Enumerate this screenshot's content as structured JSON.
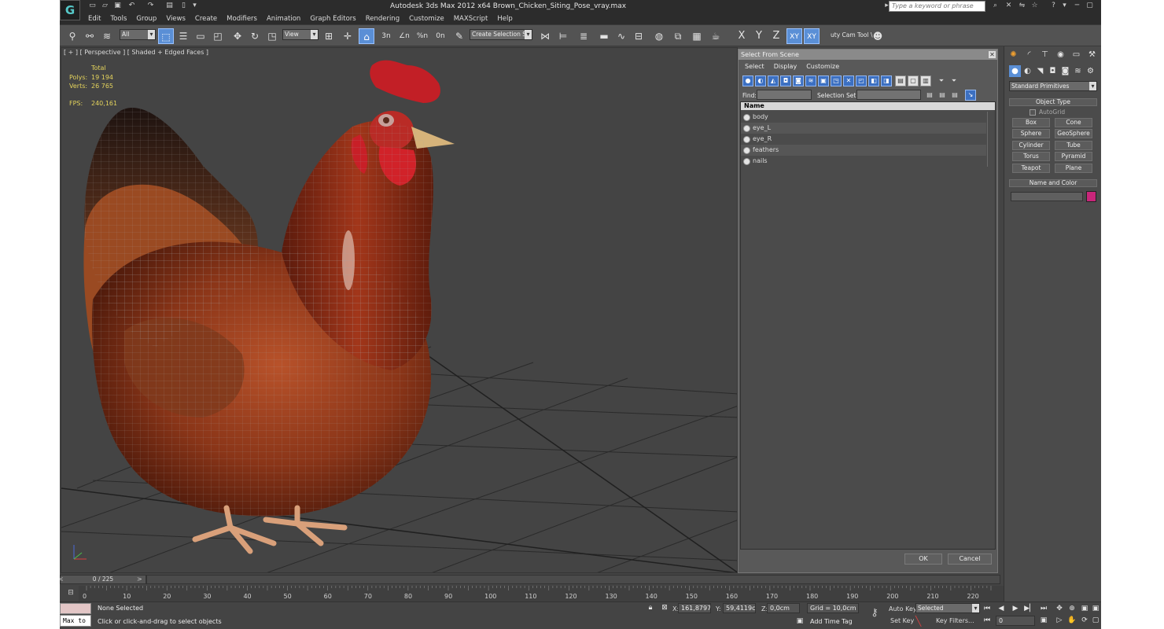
{
  "app": {
    "title": "Autodesk 3ds Max  2012 x64     Brown_Chicken_Siting_Pose_vray.max",
    "search_placeholder": "Type a keyword or phrase",
    "logo_letter": "G"
  },
  "menus": [
    "Edit",
    "Tools",
    "Group",
    "Views",
    "Create",
    "Modifiers",
    "Animation",
    "Graph Editors",
    "Rendering",
    "Customize",
    "MAXScript",
    "Help"
  ],
  "toolbar": {
    "filter_value": "All",
    "refcoord_value": "View",
    "named_selection_value": "Create Selection Se",
    "snap_labels": [
      "3n",
      "∠n",
      "%n",
      "0n"
    ],
    "axis_labels": [
      "X",
      "Y",
      "Z",
      "XY",
      "XY"
    ],
    "utility_label": "uty Cam Tool \\"
  },
  "viewport": {
    "label": "[ + ] [ Perspective ] [ Shaded + Edged Faces ]",
    "stats": {
      "total_label": "Total",
      "polys_label": "Polys:",
      "polys_value": "19 194",
      "verts_label": "Verts:",
      "verts_value": "26 765",
      "fps_label": "FPS:",
      "fps_value": "240,161"
    }
  },
  "dialog": {
    "title": "Select From Scene",
    "menus": [
      "Select",
      "Display",
      "Customize"
    ],
    "find_label": "Find:",
    "find_value": "",
    "selection_set_label": "Selection Set:",
    "selection_set_value": "",
    "column_header": "Name",
    "items": [
      "body",
      "eye_L",
      "eye_R",
      "feathers",
      "nails"
    ],
    "ok_label": "OK",
    "cancel_label": "Cancel"
  },
  "command_panel": {
    "category_value": "Standard Primitives",
    "object_type_title": "Object Type",
    "autogrid_label": "AutoGrid",
    "primitives": [
      "Box",
      "Cone",
      "Sphere",
      "GeoSphere",
      "Cylinder",
      "Tube",
      "Torus",
      "Pyramid",
      "Teapot",
      "Plane"
    ],
    "name_color_title": "Name and Color",
    "object_name_value": "",
    "object_color": "#c8267a"
  },
  "timeline": {
    "frame_display": "0 / 225",
    "ticks": [
      "0",
      "10",
      "20",
      "30",
      "40",
      "50",
      "60",
      "70",
      "80",
      "90",
      "100",
      "110",
      "120",
      "130",
      "140",
      "150",
      "160",
      "170",
      "180",
      "190",
      "200",
      "210",
      "220"
    ],
    "time_max": 225
  },
  "status": {
    "maxscript_listener": "Max to",
    "selection_text": "None Selected",
    "prompt_text": "Click or click-and-drag to select objects",
    "x_label": "X:",
    "x_value": "161,8797c",
    "y_label": "Y:",
    "y_value": "59,4119cm",
    "z_label": "Z:",
    "z_value": "0,0cm",
    "grid_text": "Grid = 10,0cm",
    "add_time_tag": "Add Time Tag",
    "auto_key_label": "Auto Key",
    "auto_key_value": "Selected",
    "set_key_label": "Set Key",
    "key_filters_label": "Key Filters...",
    "frame_value": "0"
  },
  "colors": {
    "accent": "#5a8fd6",
    "stats_text": "#e4d35c",
    "viewport_bg": "#444444"
  }
}
